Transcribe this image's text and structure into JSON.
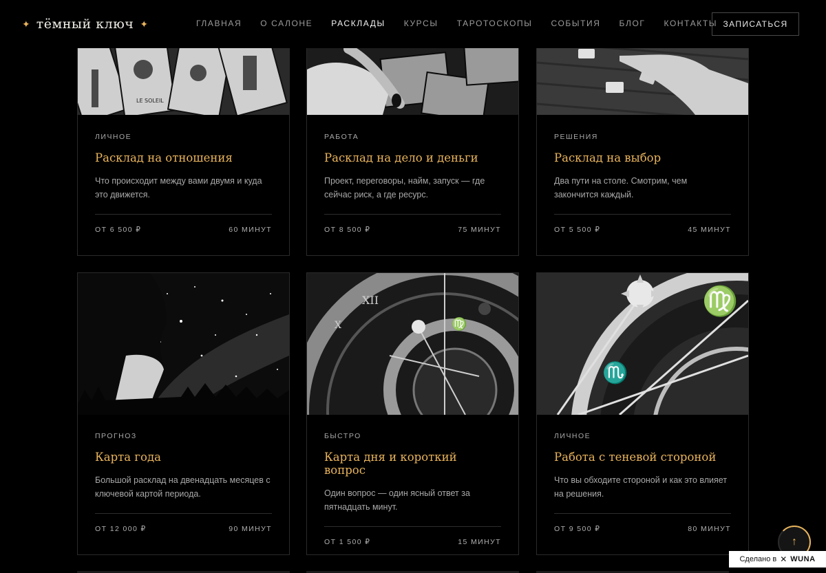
{
  "brand": {
    "name": "тёмный ключ",
    "star": "✦"
  },
  "nav": [
    {
      "label": "ГЛАВНАЯ",
      "active": false
    },
    {
      "label": "О САЛОНЕ",
      "active": false
    },
    {
      "label": "РАСКЛАДЫ",
      "active": true
    },
    {
      "label": "КУРСЫ",
      "active": false
    },
    {
      "label": "ТАРОТОСКОПЫ",
      "active": false
    },
    {
      "label": "СОБЫТИЯ",
      "active": false
    },
    {
      "label": "БЛОГ",
      "active": false
    },
    {
      "label": "КОНТАКТЫ",
      "active": false
    }
  ],
  "cta": {
    "label": "ЗАПИСАТЬСЯ"
  },
  "cards": [
    {
      "tag": "ЛИЧНОЕ",
      "title": "Расклад на отношения",
      "desc": "Что происходит между вами двумя и куда это движется.",
      "price": "ОТ 6 500 ₽",
      "duration": "60 МИНУТ",
      "image": "tarot-cards-image"
    },
    {
      "tag": "РАБОТА",
      "title": "Расклад на дело и деньги",
      "desc": "Проект, переговоры, найм, запуск — где сейчас риск, а где ресурс.",
      "price": "ОТ 8 500 ₽",
      "duration": "75 МИНУТ",
      "image": "hands-cards-image"
    },
    {
      "tag": "РЕШЕНИЯ",
      "title": "Расклад на выбор",
      "desc": "Два пути на столе. Смотрим, чем закончится каждый.",
      "price": "ОТ 5 500 ₽",
      "duration": "45 МИНУТ",
      "image": "hand-table-image"
    },
    {
      "tag": "ПРОГНОЗ",
      "title": "Карта года",
      "desc": "Большой расклад на двенадцать месяцев с ключевой картой периода.",
      "price": "ОТ 12 000 ₽",
      "duration": "90 МИНУТ",
      "image": "starry-sky-portrait-image"
    },
    {
      "tag": "БЫСТРО",
      "title": "Карта дня и короткий вопрос",
      "desc": "Один вопрос — один ясный ответ за пятнадцать минут.",
      "price": "ОТ 1 500 ₽",
      "duration": "15 МИНУТ",
      "image": "astronomical-clock-image"
    },
    {
      "tag": "ЛИЧНОЕ",
      "title": "Работа с теневой стороной",
      "desc": "Что вы обходите стороной и как это влияет на решения.",
      "price": "ОТ 9 500 ₽",
      "duration": "80 МИНУТ",
      "image": "zodiac-dial-closeup-image"
    }
  ],
  "scroll_top": {
    "icon": "arrow-up-icon",
    "glyph": "↑"
  },
  "made_with": {
    "prefix": "Сделано в",
    "brand": "WUNA"
  },
  "colors": {
    "accent": "#e9b45c",
    "background": "#000000",
    "border": "#2b2b2b"
  }
}
